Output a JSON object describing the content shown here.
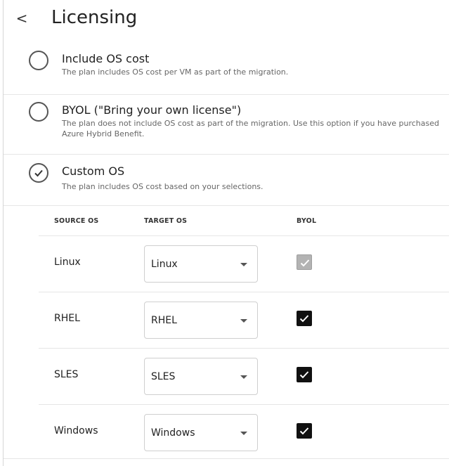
{
  "header": {
    "back_glyph": "<",
    "title": "Licensing"
  },
  "options": [
    {
      "title": "Include OS cost",
      "description": "The plan includes OS cost per VM as part of the migration.",
      "selected": false
    },
    {
      "title": "BYOL (\"Bring your own license\")",
      "description": "The plan does not include OS cost as part of the migration. Use this option if you have purchased Azure Hybrid Benefit.",
      "selected": false
    },
    {
      "title": "Custom OS",
      "description": "The plan includes OS cost based on your selections.",
      "selected": true
    }
  ],
  "table": {
    "headers": {
      "source": "SOURCE OS",
      "target": "TARGET OS",
      "byol": "BYOL"
    },
    "rows": [
      {
        "source": "Linux",
        "target": "Linux",
        "byol_checked": true,
        "byol_disabled": true
      },
      {
        "source": "RHEL",
        "target": "RHEL",
        "byol_checked": true,
        "byol_disabled": false
      },
      {
        "source": "SLES",
        "target": "SLES",
        "byol_checked": true,
        "byol_disabled": false
      },
      {
        "source": "Windows",
        "target": "Windows",
        "byol_checked": true,
        "byol_disabled": false
      }
    ]
  },
  "colors": {
    "checkbox_on": "#111111",
    "checkbox_disabled": "#b3b3b3",
    "divider": "#e6e6e6"
  }
}
